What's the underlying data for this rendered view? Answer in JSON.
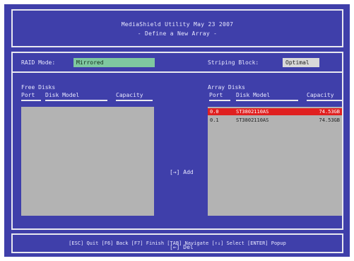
{
  "header": {
    "title": "MediaShield Utility   May 23 2007",
    "subtitle": "- Define a New Array -"
  },
  "config": {
    "raid_mode_label": "RAID Mode:",
    "raid_mode_value": "Mirrored",
    "striping_block_label": "Striping Block:",
    "striping_block_value": "Optimal"
  },
  "free_disks": {
    "title": "Free Disks",
    "columns": [
      "Port",
      "Disk Model",
      "Capacity"
    ],
    "rows": []
  },
  "array_disks": {
    "title": "Array Disks",
    "columns": [
      "Port",
      "Disk Model",
      "Capacity"
    ],
    "rows": [
      {
        "port": "0.0",
        "model": "ST3802110AS",
        "capacity": "74.53GB",
        "selected": true
      },
      {
        "port": "0.1",
        "model": "ST3802110AS",
        "capacity": "74.53GB",
        "selected": false
      }
    ]
  },
  "buttons": {
    "add": "[→] Add",
    "del": "[←] Del"
  },
  "footer": {
    "help": "[ESC] Quit  [F6] Back  [F7] Finish  [TAB] Navigate  [↑↓] Select  [ENTER] Popup"
  },
  "colors": {
    "background": "#3f3faa",
    "raid_field": "#7fc8a0",
    "selected_row": "#e02020",
    "list_box": "#b3b3b3"
  }
}
